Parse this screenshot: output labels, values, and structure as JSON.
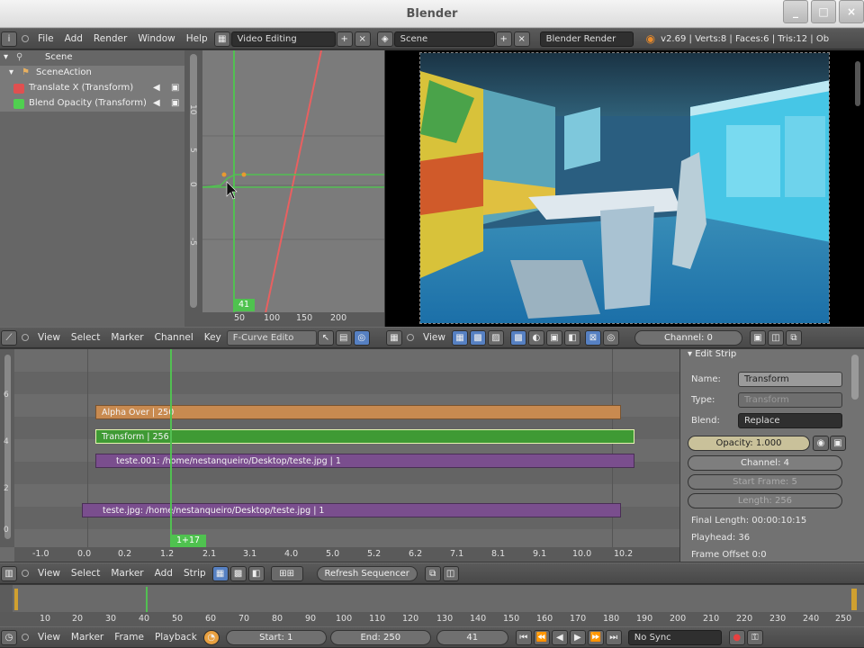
{
  "window": {
    "title": "Blender",
    "buttons": [
      "_",
      "□",
      "×"
    ]
  },
  "info_header": {
    "menus": [
      "File",
      "Add",
      "Render",
      "Window",
      "Help"
    ],
    "screen_layout": "Video Editing",
    "scene": "Scene",
    "render_engine": "Blender Render",
    "stats": "v2.69 | Verts:8 | Faces:6 | Tris:12 | Ob"
  },
  "outliner": {
    "rows": [
      {
        "label": "Scene"
      },
      {
        "label": "SceneAction"
      },
      {
        "label": "Translate X (Transform)"
      },
      {
        "label": "Blend Opacity (Transform)"
      }
    ],
    "colors": {
      "translate": "#e05050",
      "opacity": "#50d050"
    }
  },
  "graph": {
    "y_ticks": [
      "10",
      "5",
      "0",
      "-5"
    ],
    "x_ticks": [
      "50",
      "100",
      "150",
      "200"
    ],
    "frame": "41"
  },
  "graph_header": {
    "menus": [
      "View",
      "Select",
      "Marker",
      "Channel",
      "Key"
    ],
    "mode": "F-Curve Edito"
  },
  "viewer_header": {
    "menus": [
      "View"
    ],
    "channel": "Channel: 0"
  },
  "sequencer": {
    "strips": [
      {
        "label": "Alpha Over | 250",
        "color": "#c88a50"
      },
      {
        "label": "Transform | 256",
        "color": "#3f9a34"
      },
      {
        "label": "teste.001: /home/nestanqueiro/Desktop/teste.jpg | 1",
        "color": "#7a4e8e"
      },
      {
        "label": "teste.jpg: /home/nestanqueiro/Desktop/teste.jpg | 1",
        "color": "#7a4e8e"
      }
    ],
    "x_ticks": [
      "-1.0",
      "0.0",
      "0.2",
      "1.2",
      "2.1",
      "3.1",
      "4.0",
      "5.0",
      "5.2",
      "6.2",
      "7.1",
      "8.1",
      "9.1",
      "10.0",
      "10.2"
    ],
    "y_ticks": [
      "6",
      "4",
      "2",
      "0"
    ],
    "frame": "1+17"
  },
  "edit_strip": {
    "title": "Edit Strip",
    "name_label": "Name:",
    "name": "Transform",
    "type_label": "Type:",
    "type": "Transform",
    "blend_label": "Blend:",
    "blend": "Replace",
    "opacity": "Opacity: 1.000",
    "channel": "Channel: 4",
    "start_frame": "Start Frame: 5",
    "length": "Length: 256",
    "final_length": "Final Length: 00:00:10:15",
    "playhead": "Playhead: 36",
    "frame_offset": "Frame Offset 0:0"
  },
  "seq_header": {
    "menus": [
      "View",
      "Select",
      "Marker",
      "Add",
      "Strip"
    ],
    "refresh": "Refresh Sequencer"
  },
  "timeline": {
    "ticks": [
      "10",
      "20",
      "30",
      "40",
      "50",
      "60",
      "70",
      "80",
      "90",
      "100",
      "110",
      "120",
      "130",
      "140",
      "150",
      "160",
      "170",
      "180",
      "190",
      "200",
      "210",
      "220",
      "230",
      "240",
      "250"
    ]
  },
  "timeline_header": {
    "menus": [
      "View",
      "Marker",
      "Frame",
      "Playback"
    ],
    "start": "Start: 1",
    "end": "End: 250",
    "current": "41",
    "sync": "No Sync"
  }
}
